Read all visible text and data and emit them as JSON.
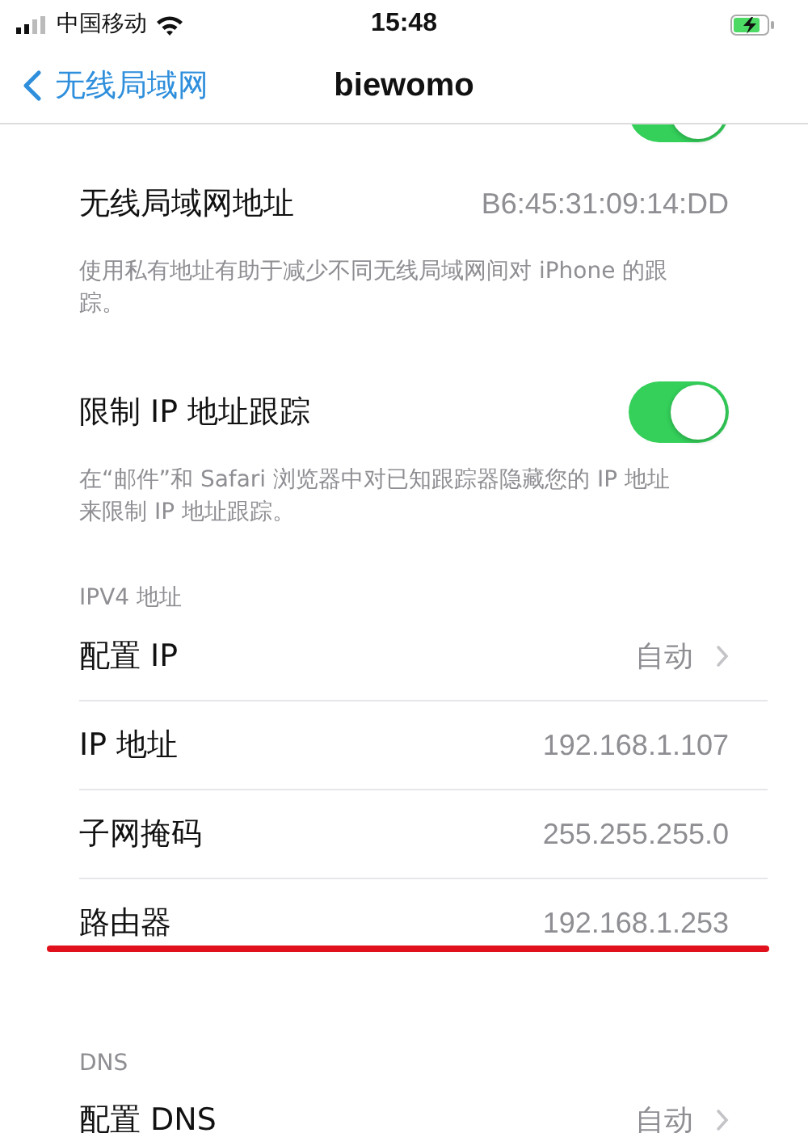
{
  "status_bar": {
    "carrier": "中国移动",
    "time": "15:48"
  },
  "nav": {
    "back": "无线局域网",
    "title": "biewomo"
  },
  "top_toggle": {
    "on": true
  },
  "sections": [
    {
      "rows": [
        {
          "kind": "value",
          "label": "无线局域网地址",
          "value": "B6:45:31:09:14:DD"
        }
      ],
      "footer": "使用私有地址有助于减少不同无线局域网间对 iPhone 的跟踪。"
    },
    {
      "rows": [
        {
          "kind": "toggle",
          "label": "限制 IP 地址跟踪",
          "on": true
        }
      ],
      "footer": "在“邮件”和 Safari 浏览器中对已知跟踪器隐藏您的 IP 地址来限制 IP 地址跟踪。"
    },
    {
      "header": "IPV4 地址",
      "rows": [
        {
          "kind": "link",
          "label": "配置 IP",
          "value": "自动"
        },
        {
          "kind": "value",
          "label": "IP 地址",
          "value": "192.168.1.107"
        },
        {
          "kind": "value",
          "label": "子网掩码",
          "value": "255.255.255.0"
        },
        {
          "kind": "value",
          "label": "路由器",
          "value": "192.168.1.253",
          "underlined": true
        }
      ]
    },
    {
      "header": "DNS",
      "rows": [
        {
          "kind": "link",
          "label": "配置 DNS",
          "value": "自动"
        }
      ]
    }
  ]
}
